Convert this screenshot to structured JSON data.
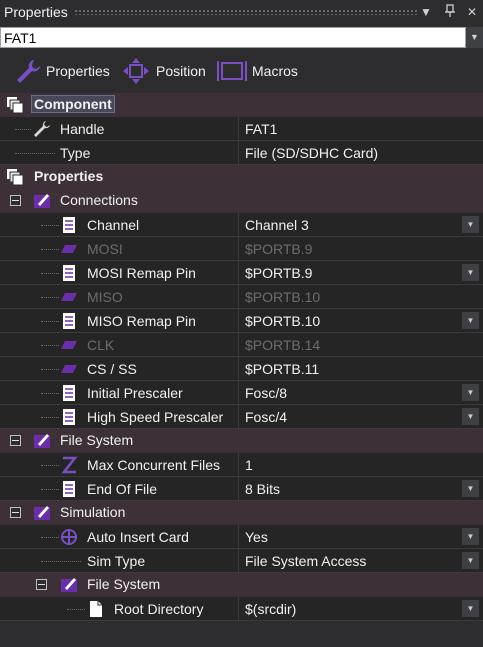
{
  "panel": {
    "title": "Properties"
  },
  "selector": {
    "value": "FAT1"
  },
  "toolbar": {
    "properties": "Properties",
    "position": "Position",
    "macros": "Macros"
  },
  "component": {
    "header": "Component",
    "handle": {
      "label": "Handle",
      "value": "FAT1"
    },
    "type": {
      "label": "Type",
      "value": "File (SD/SDHC Card)"
    }
  },
  "properties": {
    "header": "Properties",
    "connections": {
      "label": "Connections",
      "channel": {
        "label": "Channel",
        "value": "Channel 3"
      },
      "mosi": {
        "label": "MOSI",
        "value": "$PORTB.9"
      },
      "mosi_remap": {
        "label": "MOSI Remap Pin",
        "value": "$PORTB.9"
      },
      "miso": {
        "label": "MISO",
        "value": "$PORTB.10"
      },
      "miso_remap": {
        "label": "MISO Remap Pin",
        "value": "$PORTB.10"
      },
      "clk": {
        "label": "CLK",
        "value": "$PORTB.14"
      },
      "cs": {
        "label": "CS / SS",
        "value": "$PORTB.11"
      },
      "initial_prescaler": {
        "label": "Initial Prescaler",
        "value": "Fosc/8"
      },
      "high_speed_prescaler": {
        "label": "High Speed Prescaler",
        "value": "Fosc/4"
      }
    },
    "file_system": {
      "label": "File System",
      "max_files": {
        "label": "Max Concurrent Files",
        "value": "1"
      },
      "eof": {
        "label": "End Of File",
        "value": "8 Bits"
      }
    },
    "simulation": {
      "label": "Simulation",
      "auto_insert": {
        "label": "Auto Insert Card",
        "value": "Yes"
      },
      "sim_type": {
        "label": "Sim Type",
        "value": "File System Access"
      },
      "file_system": {
        "label": "File System",
        "root_dir": {
          "label": "Root Directory",
          "value": "$(srcdir)"
        }
      }
    }
  },
  "colors": {
    "background": "#2d2d30",
    "category": "#3d3038",
    "icon_purple": "#6a2fa8",
    "disabled_text": "#6d6d6d"
  }
}
